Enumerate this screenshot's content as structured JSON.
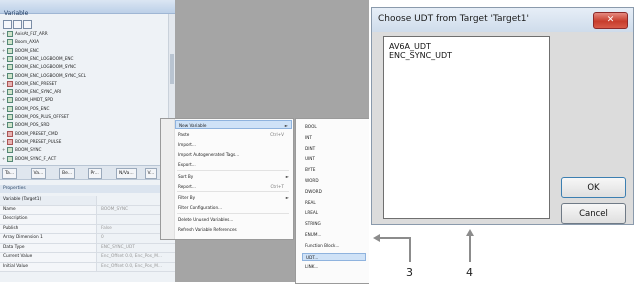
{
  "ide": {
    "panel_title": "Variable",
    "tree_items": [
      {
        "label": "AxisAt_FLT_ARR",
        "color": "green"
      },
      {
        "label": "Boom_AXIA",
        "color": "green"
      },
      {
        "label": "BOOM_ENC",
        "color": "green"
      },
      {
        "label": "BOOM_ENC_LOGBOOM_ENC",
        "color": "green"
      },
      {
        "label": "BOOM_ENC_LOGBOOM_SYNC",
        "color": "green"
      },
      {
        "label": "BOOM_ENC_LOGBOOM_SYNC_SCL",
        "color": "green"
      },
      {
        "label": "BOOM_ENC_PRESET",
        "color": "red"
      },
      {
        "label": "BOOM_ENC_SYNC_ARI",
        "color": "green"
      },
      {
        "label": "BOOM_HMDT_SPD",
        "color": "green"
      },
      {
        "label": "BOOM_POS_ENC",
        "color": "green"
      },
      {
        "label": "BOOM_POS_PLUS_OFFSET",
        "color": "green"
      },
      {
        "label": "BOOM_POS_SRD",
        "color": "green"
      },
      {
        "label": "BOOM_PRESET_CMD",
        "color": "red"
      },
      {
        "label": "BOOM_PRESET_PULSE",
        "color": "red"
      },
      {
        "label": "BOOM_SYNC",
        "color": "green"
      },
      {
        "label": "BOOM_SYNC_F_ACT",
        "color": "green"
      }
    ],
    "tabs": [
      "Ta...",
      "Va...",
      "Be...",
      "Pr...",
      "N/Va...",
      "V..."
    ],
    "properties_title": "Properties",
    "properties": [
      {
        "key": "Variable (Target1)",
        "value": ""
      },
      {
        "key": "Name",
        "value": "BOOM_SYNC"
      },
      {
        "key": "Description",
        "value": ""
      },
      {
        "key": "Publish",
        "value": "False"
      },
      {
        "key": "Array Dimension 1",
        "value": "0"
      },
      {
        "key": "Data Type",
        "value": "ENC_SYNC_UDT"
      },
      {
        "key": "Current Value",
        "value": "Enc_Offset 0.0, Enc_Pos_M..."
      },
      {
        "key": "Initial Value",
        "value": "Enc_Offset 0.0, Enc_Pos_M..."
      }
    ]
  },
  "context_menu": {
    "items": [
      {
        "label": "New Variable",
        "shortcut": "",
        "arrow": "►",
        "highlight": true,
        "sep_after": false
      },
      {
        "label": "Paste",
        "shortcut": "Ctrl+V",
        "arrow": "",
        "highlight": false,
        "sep_after": false
      },
      {
        "label": "Import...",
        "shortcut": "",
        "arrow": "",
        "highlight": false,
        "sep_after": false
      },
      {
        "label": "Import Autogenerated Tags...",
        "shortcut": "",
        "arrow": "",
        "highlight": false,
        "sep_after": false
      },
      {
        "label": "Export...",
        "shortcut": "",
        "arrow": "",
        "highlight": false,
        "sep_after": true
      },
      {
        "label": "Sort By",
        "shortcut": "",
        "arrow": "►",
        "highlight": false,
        "sep_after": false
      },
      {
        "label": "Report...",
        "shortcut": "Ctrl+T",
        "arrow": "",
        "highlight": false,
        "sep_after": true
      },
      {
        "label": "Filter By",
        "shortcut": "",
        "arrow": "►",
        "highlight": false,
        "sep_after": false
      },
      {
        "label": "Filter Configuration...",
        "shortcut": "",
        "arrow": "",
        "highlight": false,
        "sep_after": true
      },
      {
        "label": "Delete Unused Variables...",
        "shortcut": "",
        "arrow": "",
        "highlight": false,
        "sep_after": false
      },
      {
        "label": "Refresh Variable References",
        "shortcut": "",
        "arrow": "",
        "highlight": false,
        "sep_after": false
      }
    ]
  },
  "submenu": {
    "items": [
      "BOOL",
      "INT",
      "DINT",
      "UINT",
      "BYTE",
      "WORD",
      "DWORD",
      "REAL",
      "LREAL",
      "STRING",
      "ENUM...",
      "Function Block...",
      "UDT...",
      "LINK..."
    ],
    "highlight_index": 12
  },
  "dialog": {
    "title": "Choose UDT from Target 'Target1'",
    "close_glyph": "✕",
    "list_items": [
      "AV6A_UDT",
      "ENC_SYNC_UDT"
    ],
    "ok_label": "OK",
    "cancel_label": "Cancel"
  },
  "callouts": {
    "label_3": "3",
    "label_4": "4"
  }
}
